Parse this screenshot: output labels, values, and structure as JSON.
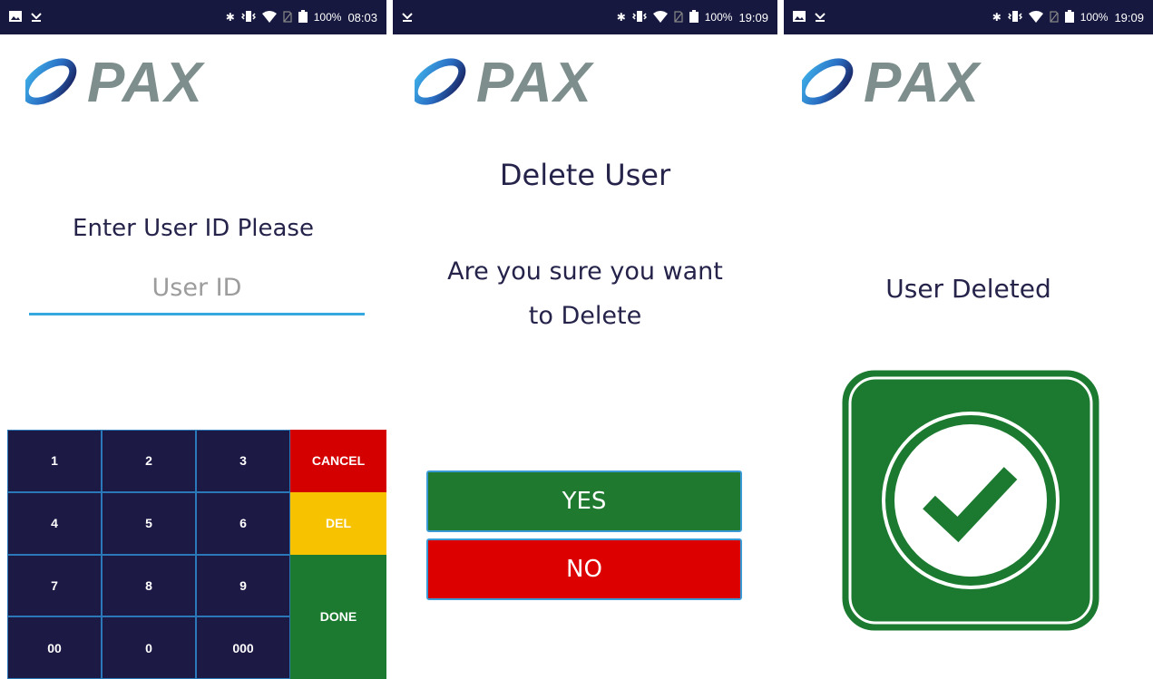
{
  "status_bars": [
    {
      "time": "08:03",
      "battery": "100%"
    },
    {
      "time": "19:09",
      "battery": "100%"
    },
    {
      "time": "19:09",
      "battery": "100%"
    }
  ],
  "logo_text": "PAX",
  "screen1": {
    "title": "Enter User ID Please",
    "input_placeholder": "User ID",
    "input_value": "",
    "keys": {
      "k1": "1",
      "k2": "2",
      "k3": "3",
      "k4": "4",
      "k5": "5",
      "k6": "6",
      "k7": "7",
      "k8": "8",
      "k9": "9",
      "k00": "00",
      "k0": "0",
      "k000": "000",
      "cancel": "CANCEL",
      "del": "DEL",
      "done": "DONE"
    }
  },
  "screen2": {
    "title": "Delete User",
    "message_line1": "Are you sure you want",
    "message_line2": "to Delete",
    "yes_label": "YES",
    "no_label": "NO"
  },
  "screen3": {
    "message": "User Deleted"
  },
  "colors": {
    "statusbar": "#16183f",
    "keypad_bg": "#1c1945",
    "cancel": "#d40000",
    "del": "#f7c300",
    "done": "#1b7a30",
    "input_underline": "#35a8e0"
  },
  "icons": [
    "image-icon",
    "missed-call-icon",
    "bluetooth-icon",
    "vibrate-icon",
    "wifi-icon",
    "no-sim-icon",
    "battery-icon",
    "check-icon"
  ]
}
